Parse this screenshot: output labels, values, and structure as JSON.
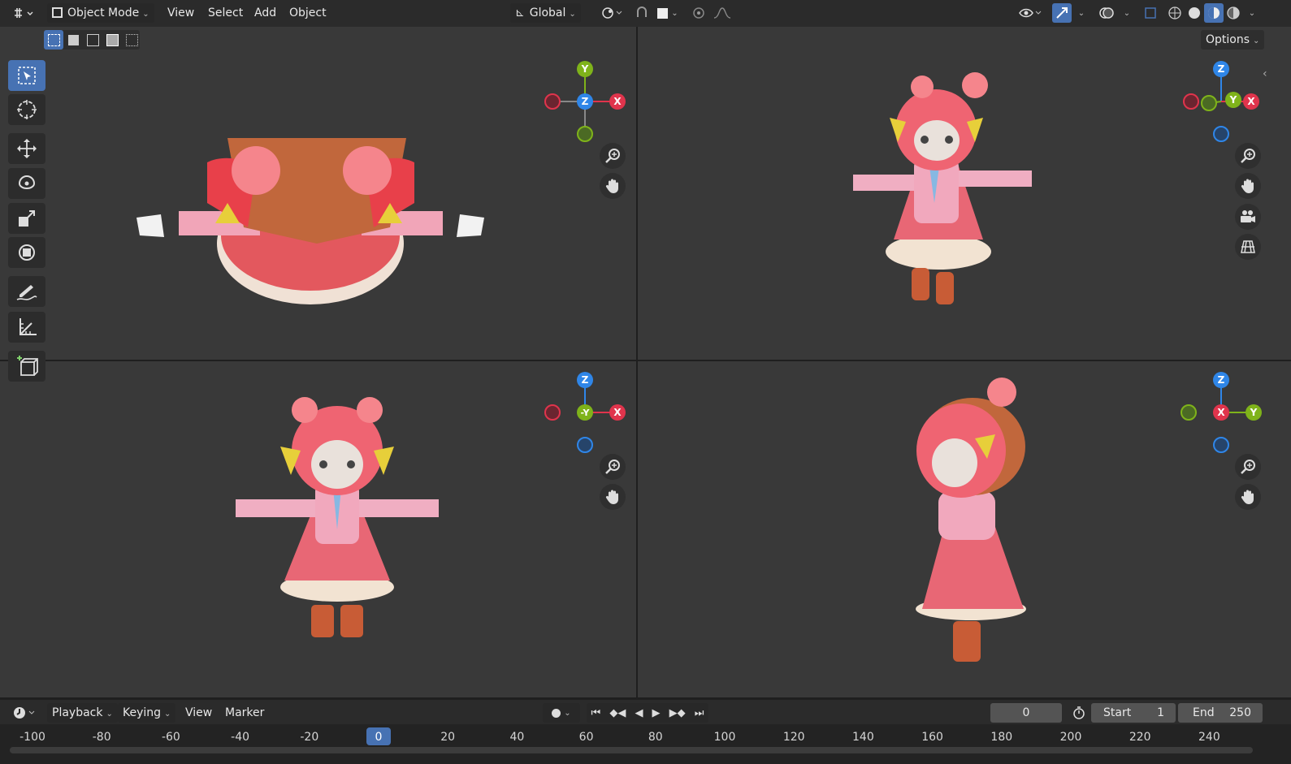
{
  "header": {
    "mode": "Object Mode",
    "menu": [
      "View",
      "Select",
      "Add",
      "Object"
    ],
    "orientation": "Global",
    "options": "Options"
  },
  "viewports": {
    "top_left": {
      "gizmo_center": "Z",
      "up": "Y",
      "right": "X"
    },
    "top_right": {
      "gizmo_center": "",
      "up": "Z",
      "right": "X",
      "mid": "Y"
    },
    "bottom_left": {
      "gizmo_center": "-Y",
      "up": "Z",
      "right": "X"
    },
    "bottom_right": {
      "gizmo_center": "X",
      "up": "Z",
      "right": "Y"
    }
  },
  "timeline": {
    "menu": [
      "Playback",
      "Keying",
      "View",
      "Marker"
    ],
    "current_frame": "0",
    "start_label": "Start",
    "start_value": "1",
    "end_label": "End",
    "end_value": "250",
    "ruler_ticks": [
      "-100",
      "-80",
      "-60",
      "-40",
      "-20",
      "0",
      "20",
      "40",
      "60",
      "80",
      "100",
      "120",
      "140",
      "160",
      "180",
      "200",
      "220",
      "240"
    ]
  },
  "colors": {
    "accent": "#4772b3",
    "axis_x": "#e0344c",
    "axis_y": "#7fb31a",
    "axis_z": "#2f86e8"
  },
  "icons": [
    "editor-type-icon",
    "select-box-icon",
    "cursor-icon",
    "move-icon",
    "rotate-icon",
    "scale-icon",
    "transform-icon",
    "annotate-icon",
    "measure-icon",
    "add-cube-icon",
    "zoom-icon",
    "hand-pan-icon",
    "camera-icon",
    "grid-icon"
  ]
}
